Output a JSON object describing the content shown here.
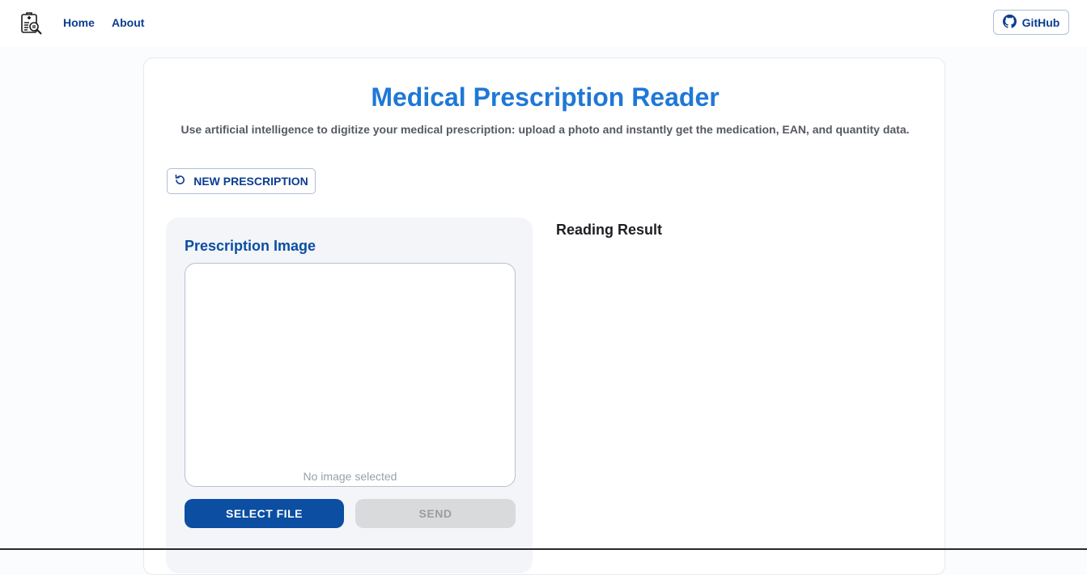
{
  "nav": {
    "logo_icon": "prescription-search-icon",
    "home_label": "Home",
    "about_label": "About",
    "github_label": "GitHub",
    "github_icon": "github-icon"
  },
  "page": {
    "title": "Medical Prescription Reader",
    "subtitle": "Use artificial intelligence to digitize your medical prescription: upload a photo and instantly get the medication, EAN, and quantity data.",
    "new_prescription_label": "NEW PRESCRIPTION",
    "new_prescription_icon": "refresh-icon"
  },
  "upload_panel": {
    "title": "Prescription Image",
    "empty_text": "No image selected",
    "select_file_label": "SELECT FILE",
    "send_label": "SEND",
    "send_enabled": false
  },
  "result": {
    "title": "Reading Result"
  },
  "colors": {
    "primary": "#0b4ea2",
    "title_blue": "#1e78d6",
    "nav_text": "#0b3d91",
    "disabled_bg": "#d9dadc",
    "panel_bg": "#f3f5f9"
  }
}
